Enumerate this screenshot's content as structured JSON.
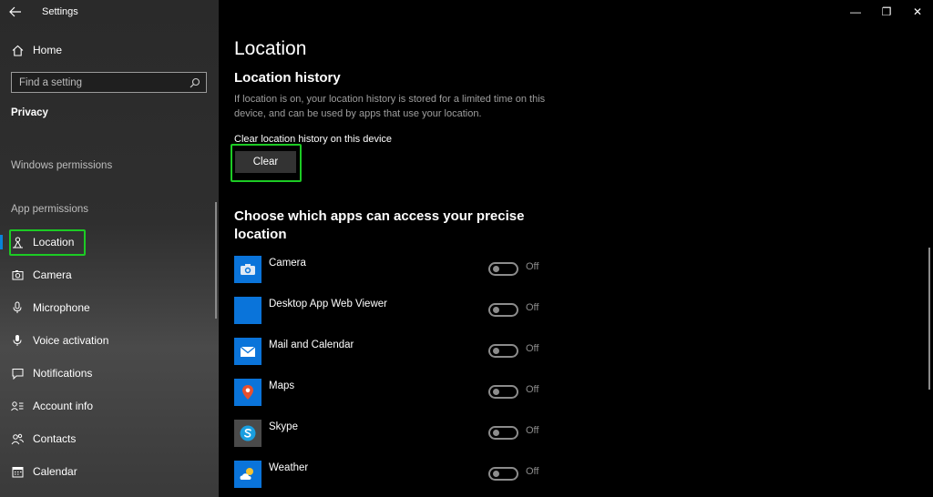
{
  "window": {
    "title": "Settings",
    "controls": {
      "minimize": "—",
      "restore": "❐",
      "close": "✕"
    }
  },
  "sidebar": {
    "back_icon": "back-arrow-icon",
    "home": {
      "label": "Home",
      "icon": "home-icon"
    },
    "search": {
      "placeholder": "Find a setting",
      "icon": "search-icon"
    },
    "section": "Privacy",
    "groups": [
      {
        "label": "Windows permissions"
      },
      {
        "label": "App permissions"
      }
    ],
    "items": [
      {
        "label": "Location",
        "icon": "location-icon",
        "selected": true
      },
      {
        "label": "Camera",
        "icon": "camera-icon"
      },
      {
        "label": "Microphone",
        "icon": "microphone-icon"
      },
      {
        "label": "Voice activation",
        "icon": "voice-activation-icon"
      },
      {
        "label": "Notifications",
        "icon": "notifications-icon"
      },
      {
        "label": "Account info",
        "icon": "account-info-icon"
      },
      {
        "label": "Contacts",
        "icon": "contacts-icon"
      },
      {
        "label": "Calendar",
        "icon": "calendar-icon"
      }
    ]
  },
  "main": {
    "title": "Location",
    "history": {
      "title": "Location history",
      "description": "If location is on, your location history is stored for a limited time on this device, and can be used by apps that use your location.",
      "clear_label": "Clear location history on this device",
      "clear_button": "Clear"
    },
    "apps_title": "Choose which apps can access your precise location",
    "apps": [
      {
        "name": "Camera",
        "state": "Off",
        "icon": "camera-app-icon"
      },
      {
        "name": "Desktop App Web Viewer",
        "state": "Off",
        "icon": "web-viewer-app-icon"
      },
      {
        "name": "Mail and Calendar",
        "state": "Off",
        "icon": "mail-app-icon"
      },
      {
        "name": "Maps",
        "state": "Off",
        "icon": "maps-app-icon"
      },
      {
        "name": "Skype",
        "state": "Off",
        "icon": "skype-app-icon"
      },
      {
        "name": "Weather",
        "state": "Off",
        "icon": "weather-app-icon"
      }
    ]
  },
  "colors": {
    "accent": "#0a84d8",
    "highlight": "#1ccb24",
    "app_tile": "#0a74da"
  }
}
